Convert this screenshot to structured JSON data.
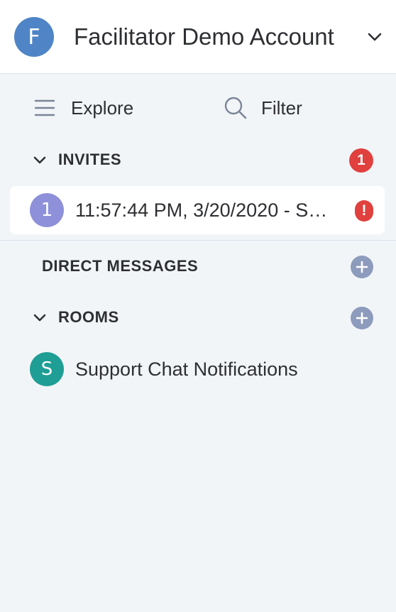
{
  "account": {
    "avatar_letter": "F",
    "name": "Facilitator Demo Account",
    "avatar_color": "#4f85c6"
  },
  "toolbar": {
    "explore_label": "Explore",
    "filter_label": "Filter"
  },
  "sections": {
    "invites": {
      "title": "INVITES",
      "count": "1",
      "items": [
        {
          "avatar_letter": "1",
          "label": "11:57:44 PM, 3/20/2020 - S…",
          "alert": "!"
        }
      ]
    },
    "direct_messages": {
      "title": "DIRECT MESSAGES"
    },
    "rooms": {
      "title": "ROOMS",
      "items": [
        {
          "avatar_letter": "S",
          "name": "Support Chat Notifications",
          "avatar_color": "#1e9e95"
        }
      ]
    }
  },
  "icons": {
    "account_menu": "chevron-down-icon",
    "explore": "menu-icon",
    "filter": "search-icon",
    "collapse": "chevron-down-icon",
    "add": "plus-icon"
  },
  "colors": {
    "background": "#f2f5f8",
    "badge_red": "#e0403e",
    "add_button": "#8d9bbd",
    "invite_avatar": "#8e90d9"
  }
}
